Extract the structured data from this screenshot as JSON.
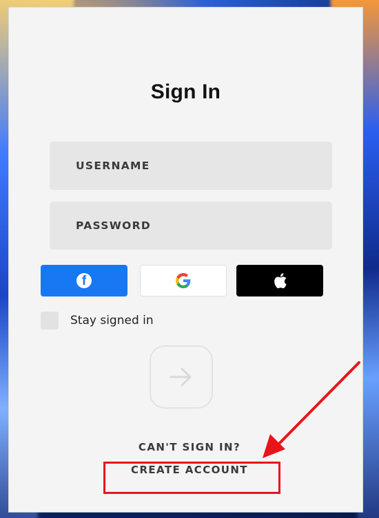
{
  "signin": {
    "title": "Sign In",
    "username_placeholder": "USERNAME",
    "password_placeholder": "PASSWORD",
    "stay_signed_in": "Stay signed in",
    "cant_sign_in": "CAN'T SIGN IN?",
    "create_account": "CREATE ACCOUNT"
  },
  "social": {
    "facebook_icon": "facebook-icon",
    "google_icon": "google-icon",
    "apple_icon": "apple-icon"
  },
  "colors": {
    "facebook": "#1877f2",
    "apple": "#000000",
    "annotation": "#e8141a"
  }
}
